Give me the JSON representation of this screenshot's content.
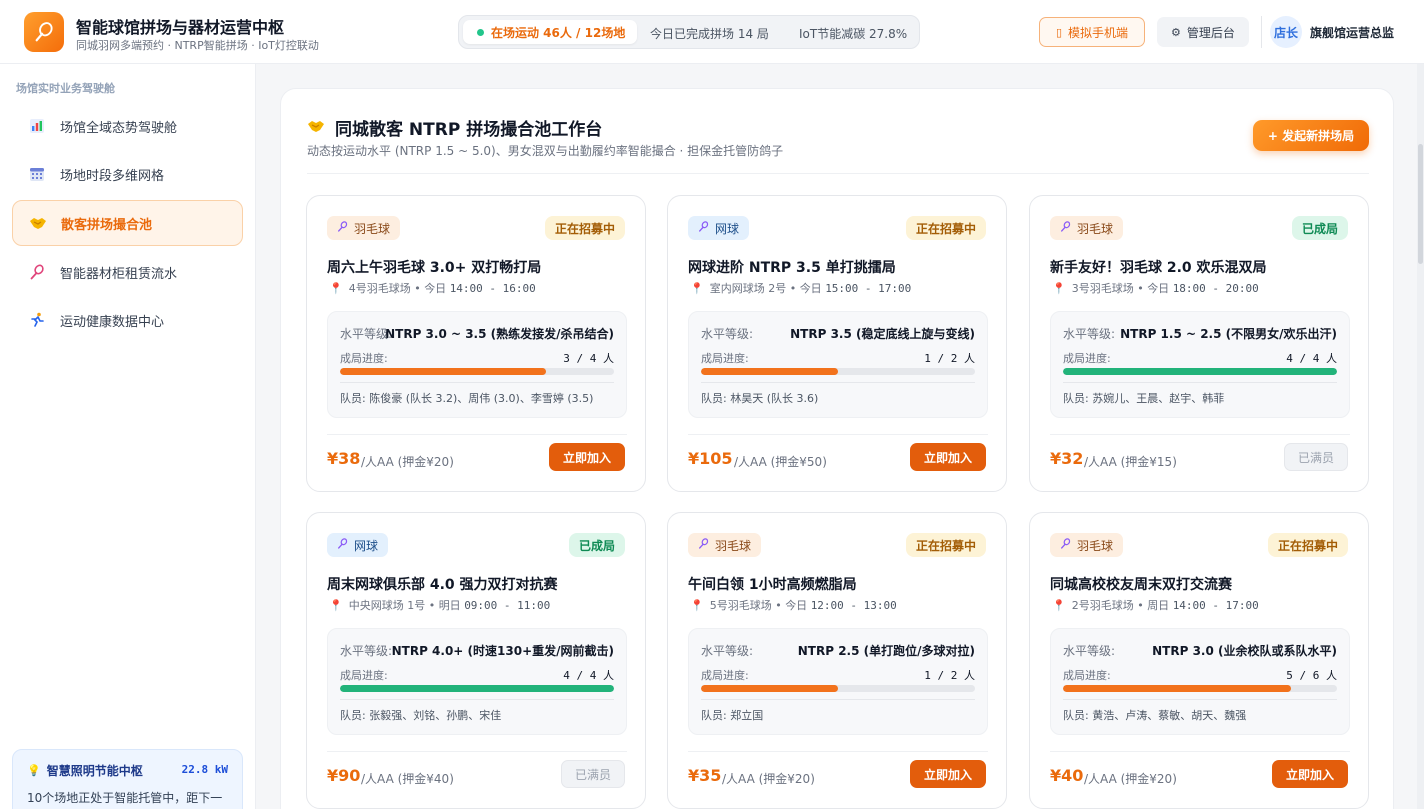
{
  "header": {
    "title": "智能球馆拼场与器材运营中枢",
    "subtitle": "同城羽网多端预约 · NTRP智能拼场 · IoT灯控联动",
    "stat_live": "在场运动 46人 / 12场地",
    "stat_done": "今日已完成拼场 14 局",
    "stat_iot": "IoT节能减碳 27.8%",
    "mobile_btn": "模拟手机端",
    "admin_btn": "管理后台",
    "avatar": "店长",
    "user_name": "旗舰馆运营总监"
  },
  "sidebar": {
    "heading": "场馆实时业务驾驶舱",
    "items": [
      {
        "label": "场馆全域态势驾驶舱",
        "icon": "bar-chart-icon"
      },
      {
        "label": "场地时段多维网格",
        "icon": "calendar-grid-icon"
      },
      {
        "label": "散客拼场撮合池",
        "icon": "handshake-icon",
        "active": true
      },
      {
        "label": "智能器材柜租赁流水",
        "icon": "racket-icon"
      },
      {
        "label": "运动健康数据中心",
        "icon": "runner-icon"
      }
    ],
    "energy": {
      "title": "智慧照明节能中枢",
      "kw": "22.8 kW",
      "desc": "10个场地正处于智能托管中，距下一"
    }
  },
  "panel": {
    "title": "同城散客 NTRP 拼场撮合池工作台",
    "subtitle": "动态按运动水平 (NTRP 1.5 ~ 5.0)、男女混双与出勤履约率智能撮合 · 担保金托管防鸽子",
    "new_btn": "+ 发起新拼场局"
  },
  "labels": {
    "level": "水平等级:",
    "progress": "成局进度:",
    "join": "立即加入",
    "full": "已满员",
    "unit_prefix": "/人AA"
  },
  "cards": [
    {
      "sport": "羽毛球",
      "sport_type": "badminton",
      "status": "正在招募中",
      "status_type": "recruiting",
      "title": "周六上午羽毛球 3.0+ 双打畅打局",
      "venue": "4号羽毛球场",
      "day": "今日",
      "time": "14:00 - 16:00",
      "level": "NTRP 3.0 ~ 3.5 (熟练发接发/杀吊结合)",
      "joined": 3,
      "capacity": 4,
      "count_text": "3 / 4 人",
      "members": "队员: 陈俊豪 (队长 3.2)、周伟 (3.0)、李雪婷 (3.5)",
      "price": "¥38",
      "deposit": "/人AA (押金¥20)",
      "full": false
    },
    {
      "sport": "网球",
      "sport_type": "tennis",
      "status": "正在招募中",
      "status_type": "recruiting",
      "title": "网球进阶 NTRP 3.5 单打挑擂局",
      "venue": "室内网球场 2号",
      "day": "今日",
      "time": "15:00 - 17:00",
      "level": "NTRP 3.5 (稳定底线上旋与变线)",
      "joined": 1,
      "capacity": 2,
      "count_text": "1 / 2 人",
      "members": "队员: 林昊天 (队长 3.6)",
      "price": "¥105",
      "deposit": "/人AA (押金¥50)",
      "full": false
    },
    {
      "sport": "羽毛球",
      "sport_type": "badminton",
      "status": "已成局",
      "status_type": "formed",
      "title": "新手友好！羽毛球 2.0 欢乐混双局",
      "venue": "3号羽毛球场",
      "day": "今日",
      "time": "18:00 - 20:00",
      "level": "NTRP 1.5 ~ 2.5 (不限男女/欢乐出汗)",
      "joined": 4,
      "capacity": 4,
      "count_text": "4 / 4 人",
      "members": "队员: 苏婉儿、王晨、赵宇、韩菲",
      "price": "¥32",
      "deposit": "/人AA (押金¥15)",
      "full": true
    },
    {
      "sport": "网球",
      "sport_type": "tennis",
      "status": "已成局",
      "status_type": "formed",
      "title": "周末网球俱乐部 4.0 强力双打对抗赛",
      "venue": "中央网球场 1号",
      "day": "明日",
      "time": "09:00 - 11:00",
      "level": "NTRP 4.0+ (时速130+重发/网前截击)",
      "joined": 4,
      "capacity": 4,
      "count_text": "4 / 4 人",
      "members": "队员: 张毅强、刘铭、孙鹏、宋佳",
      "price": "¥90",
      "deposit": "/人AA (押金¥40)",
      "full": true
    },
    {
      "sport": "羽毛球",
      "sport_type": "badminton",
      "status": "正在招募中",
      "status_type": "recruiting",
      "title": "午间白领 1小时高频燃脂局",
      "venue": "5号羽毛球场",
      "day": "今日",
      "time": "12:00 - 13:00",
      "level": "NTRP 2.5 (单打跑位/多球对拉)",
      "joined": 1,
      "capacity": 2,
      "count_text": "1 / 2 人",
      "members": "队员: 郑立国",
      "price": "¥35",
      "deposit": "/人AA (押金¥20)",
      "full": false
    },
    {
      "sport": "羽毛球",
      "sport_type": "badminton",
      "status": "正在招募中",
      "status_type": "recruiting",
      "title": "同城高校校友周末双打交流赛",
      "venue": "2号羽毛球场",
      "day": "周日",
      "time": "14:00 - 17:00",
      "level": "NTRP 3.0 (业余校队或系队水平)",
      "joined": 5,
      "capacity": 6,
      "count_text": "5 / 6 人",
      "members": "队员: 黄浩、卢涛、蔡敏、胡天、魏强",
      "price": "¥40",
      "deposit": "/人AA (押金¥20)",
      "full": false
    }
  ],
  "colors": {
    "accent": "#ea6a0c",
    "success": "#22b37a",
    "brand_gradient_from": "#ff9f2e"
  }
}
